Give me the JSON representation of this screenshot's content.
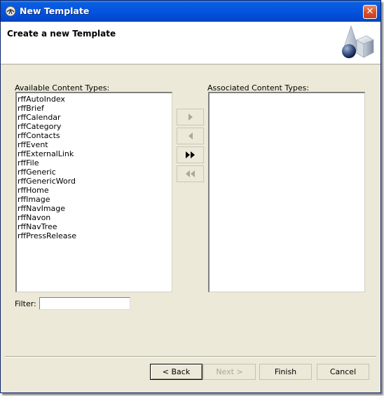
{
  "window": {
    "title": "New Template",
    "close_glyph": "✕"
  },
  "header": {
    "title": "Create a new Template",
    "graphic_icon": "template-shapes-graphic"
  },
  "available": {
    "label": "Available Content Types:",
    "items": [
      "rffAutoIndex",
      "rffBrief",
      "rffCalendar",
      "rffCategory",
      "rffContacts",
      "rffEvent",
      "rffExternalLink",
      "rffFile",
      "rffGeneric",
      "rffGenericWord",
      "rffHome",
      "rffImage",
      "rffNavImage",
      "rffNavon",
      "rffNavTree",
      "rffPressRelease"
    ]
  },
  "associated": {
    "label": "Associated Content Types:",
    "items": []
  },
  "move_buttons": {
    "add_icon": "arrow-right-icon",
    "remove_icon": "arrow-left-icon",
    "add_all_icon": "double-arrow-right-icon",
    "remove_all_icon": "double-arrow-left-icon"
  },
  "filter": {
    "label": "Filter:",
    "value": ""
  },
  "buttons": {
    "back": "< Back",
    "next": "Next >",
    "finish": "Finish",
    "cancel": "Cancel"
  },
  "colors": {
    "titlebar": "#0554df",
    "dialog_bg": "#ece9d8",
    "disabled_text": "#a9a7a0"
  }
}
